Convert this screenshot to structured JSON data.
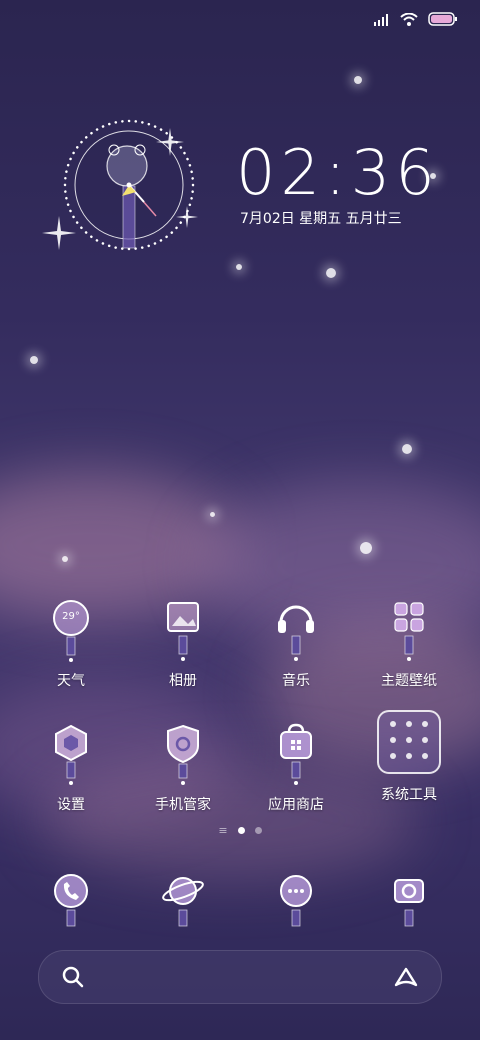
{
  "status_bar": {
    "signal_icon": "signal-icon",
    "wifi_icon": "wifi-icon",
    "battery_icon": "battery-icon"
  },
  "clock_widget": {
    "time": "02:36",
    "date": "7月02日 星期五 五月廿三",
    "analog_icon": "analog-clock-icon"
  },
  "apps_row1": [
    {
      "label": "天气",
      "icon": "weather-icon",
      "badge": "29°"
    },
    {
      "label": "相册",
      "icon": "gallery-icon"
    },
    {
      "label": "音乐",
      "icon": "music-icon"
    },
    {
      "label": "主题壁纸",
      "icon": "themes-icon"
    }
  ],
  "apps_row2": [
    {
      "label": "设置",
      "icon": "settings-icon"
    },
    {
      "label": "手机管家",
      "icon": "security-icon"
    },
    {
      "label": "应用商店",
      "icon": "app-store-icon"
    },
    {
      "label": "系统工具",
      "icon": "tools-folder-icon"
    }
  ],
  "page_indicator": {
    "pages": 2,
    "current": 1
  },
  "dock": [
    {
      "icon": "phone-icon"
    },
    {
      "icon": "browser-icon"
    },
    {
      "icon": "messages-icon"
    },
    {
      "icon": "camera-icon"
    }
  ],
  "search_bar": {
    "search_icon": "search-icon",
    "assistant_icon": "assistant-icon"
  }
}
